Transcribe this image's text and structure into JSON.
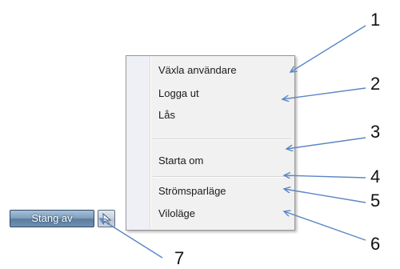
{
  "menu": {
    "items": [
      {
        "label": "Växla användare"
      },
      {
        "label": "Logga ut"
      },
      {
        "label": "Lås"
      },
      {
        "label": "Starta om"
      },
      {
        "label": "Strömsparläge"
      },
      {
        "label": "Viloläge"
      }
    ]
  },
  "shutdown": {
    "button_label": "Stäng av",
    "arrow_icon": "options-arrow-icon"
  },
  "callouts": [
    "1",
    "2",
    "3",
    "4",
    "5",
    "6",
    "7"
  ],
  "colors": {
    "arrow": "#5b86c4",
    "button_blue": "#6f90b0"
  }
}
